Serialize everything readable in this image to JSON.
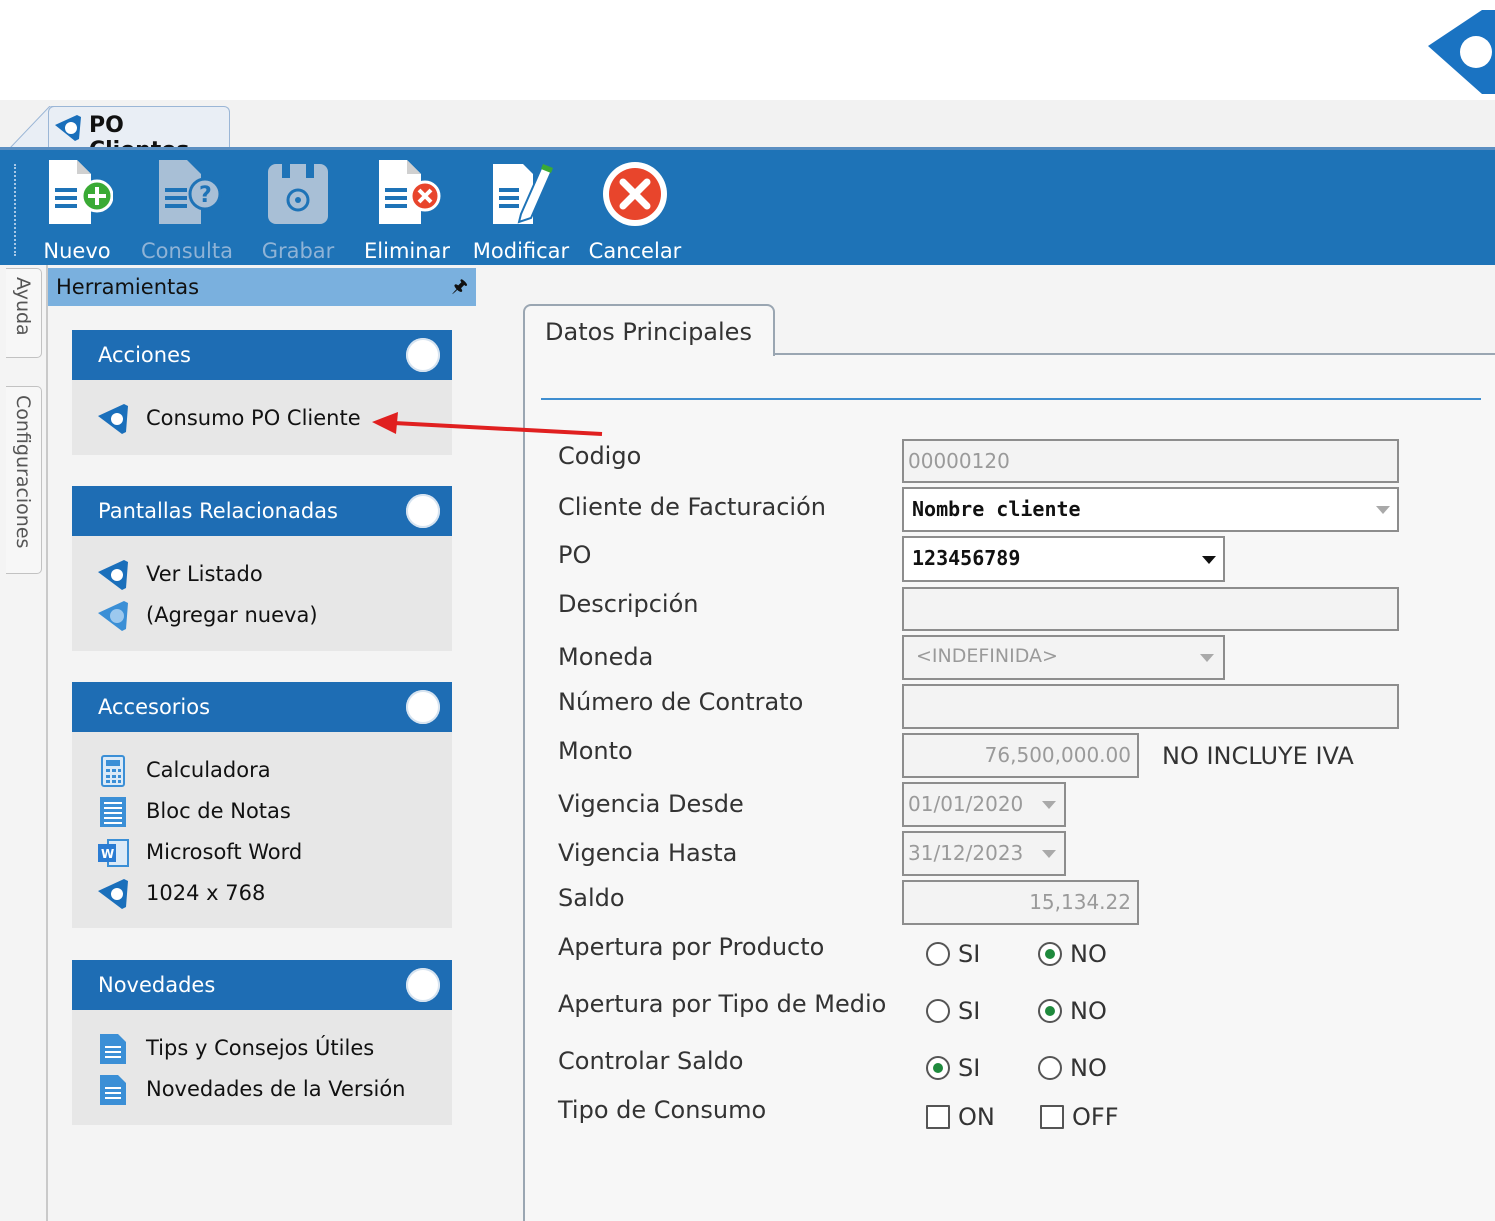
{
  "tab": {
    "label": "PO Clientes"
  },
  "toolbar": {
    "buttons": [
      {
        "label": "Nuevo",
        "icon": "new-document-icon",
        "enabled": true
      },
      {
        "label": "Consulta",
        "icon": "query-document-icon",
        "enabled": false
      },
      {
        "label": "Grabar",
        "icon": "save-disk-icon",
        "enabled": false
      },
      {
        "label": "Eliminar",
        "icon": "delete-document-icon",
        "enabled": true
      },
      {
        "label": "Modificar",
        "icon": "edit-document-icon",
        "enabled": true
      },
      {
        "label": "Cancelar",
        "icon": "cancel-circle-icon",
        "enabled": true
      }
    ]
  },
  "side_tabs": [
    "Ayuda",
    "Configuraciones"
  ],
  "tools": {
    "title": "Herramientas",
    "pin": "🖈",
    "groups": [
      {
        "title": "Acciones",
        "items": [
          {
            "label": "Consumo PO Cliente",
            "icon": "app-logo-icon"
          }
        ]
      },
      {
        "title": "Pantallas Relacionadas",
        "items": [
          {
            "label": "Ver Listado",
            "icon": "app-logo-icon"
          },
          {
            "label": "(Agregar nueva)",
            "icon": "app-logo-add-icon"
          }
        ]
      },
      {
        "title": "Accesorios",
        "items": [
          {
            "label": "Calculadora",
            "icon": "calculator-icon"
          },
          {
            "label": "Bloc de Notas",
            "icon": "notepad-icon"
          },
          {
            "label": "Microsoft Word",
            "icon": "word-icon"
          },
          {
            "label": "1024 x 768",
            "icon": "app-logo-icon"
          }
        ]
      },
      {
        "title": "Novedades",
        "items": [
          {
            "label": "Tips y Consejos Útiles",
            "icon": "document-list-icon"
          },
          {
            "label": "Novedades de la Versión",
            "icon": "document-list-icon"
          }
        ]
      }
    ]
  },
  "form": {
    "tab_label": "Datos Principales",
    "fields": {
      "codigo": {
        "label": "Codigo",
        "value": "00000120"
      },
      "cliente": {
        "label": "Cliente de Facturación",
        "value": "Nombre cliente"
      },
      "po": {
        "label": "PO",
        "value": "123456789"
      },
      "descripcion": {
        "label": "Descripción",
        "value": ""
      },
      "moneda": {
        "label": "Moneda",
        "value": "<INDEFINIDA>"
      },
      "contrato": {
        "label": "Número de Contrato",
        "value": ""
      },
      "monto": {
        "label": "Monto",
        "value": "76,500,000.00",
        "note": "NO INCLUYE IVA"
      },
      "desde": {
        "label": "Vigencia Desde",
        "value": "01/01/2020"
      },
      "hasta": {
        "label": "Vigencia Hasta",
        "value": "31/12/2023"
      },
      "saldo": {
        "label": "Saldo",
        "value": "15,134.22"
      }
    },
    "options": {
      "apertura_producto": {
        "label": "Apertura por Producto",
        "yes": "SI",
        "no": "NO",
        "selected": "NO"
      },
      "apertura_medio": {
        "label": "Apertura por Tipo de Medio",
        "yes": "SI",
        "no": "NO",
        "selected": "NO"
      },
      "controlar_saldo": {
        "label": "Controlar Saldo",
        "yes": "SI",
        "no": "NO",
        "selected": "SI"
      },
      "tipo_consumo": {
        "label": "Tipo de Consumo",
        "on": "ON",
        "off": "OFF",
        "checked": []
      }
    }
  },
  "colors": {
    "toolbar": "#1e73b7",
    "group_header": "#1e6db4",
    "panel_header": "#7ab0de",
    "annotation_arrow": "#e02020"
  }
}
